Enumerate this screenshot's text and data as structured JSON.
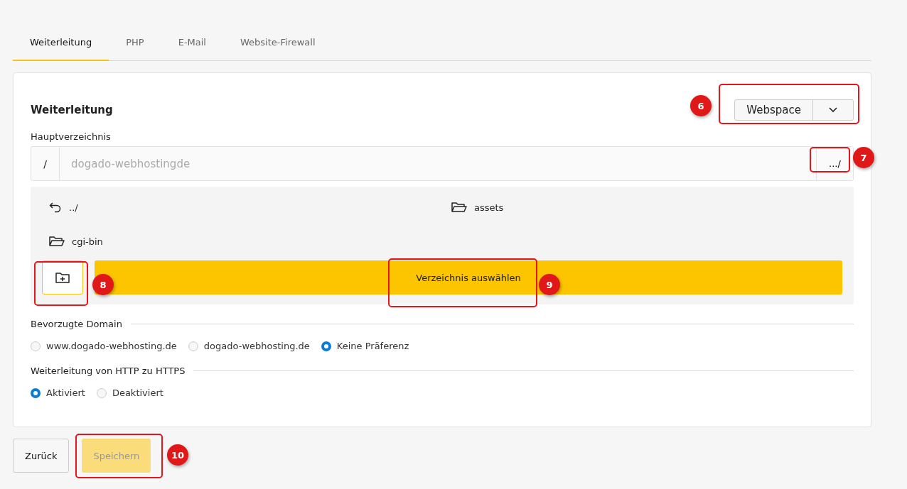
{
  "tabs": [
    {
      "label": "Weiterleitung",
      "selected": true
    },
    {
      "label": "PHP",
      "selected": false
    },
    {
      "label": "E-Mail",
      "selected": false
    },
    {
      "label": "Website-Firewall",
      "selected": false
    }
  ],
  "card": {
    "title": "Weiterleitung",
    "source_select": {
      "value": "Webspace"
    },
    "root_dir": {
      "label": "Hauptverzeichnis",
      "prefix": "/",
      "placeholder": "dogado-webhostingde",
      "browse_button": ".../"
    },
    "browser": {
      "items": [
        {
          "kind": "up",
          "label": "../"
        },
        {
          "kind": "folder",
          "label": "assets"
        },
        {
          "kind": "folder",
          "label": "cgi-bin"
        }
      ],
      "select_button": "Verzeichnis auswählen"
    },
    "preferred_domain": {
      "label": "Bevorzugte Domain",
      "options": [
        {
          "label": "www.dogado-webhosting.de",
          "selected": false
        },
        {
          "label": "dogado-webhosting.de",
          "selected": false
        },
        {
          "label": "Keine Präferenz",
          "selected": true
        }
      ]
    },
    "https_redirect": {
      "label": "Weiterleitung von HTTP zu HTTPS",
      "options": [
        {
          "label": "Aktiviert",
          "selected": true
        },
        {
          "label": "Deaktiviert",
          "selected": false
        }
      ]
    }
  },
  "buttons": [
    {
      "label": "Zurück",
      "kind": "secondary",
      "disabled": false
    },
    {
      "label": "Speichern",
      "kind": "primary",
      "disabled": true
    }
  ],
  "annotations": [
    {
      "label": "6"
    },
    {
      "label": "7"
    },
    {
      "label": "8"
    },
    {
      "label": "9"
    },
    {
      "label": "10"
    }
  ]
}
